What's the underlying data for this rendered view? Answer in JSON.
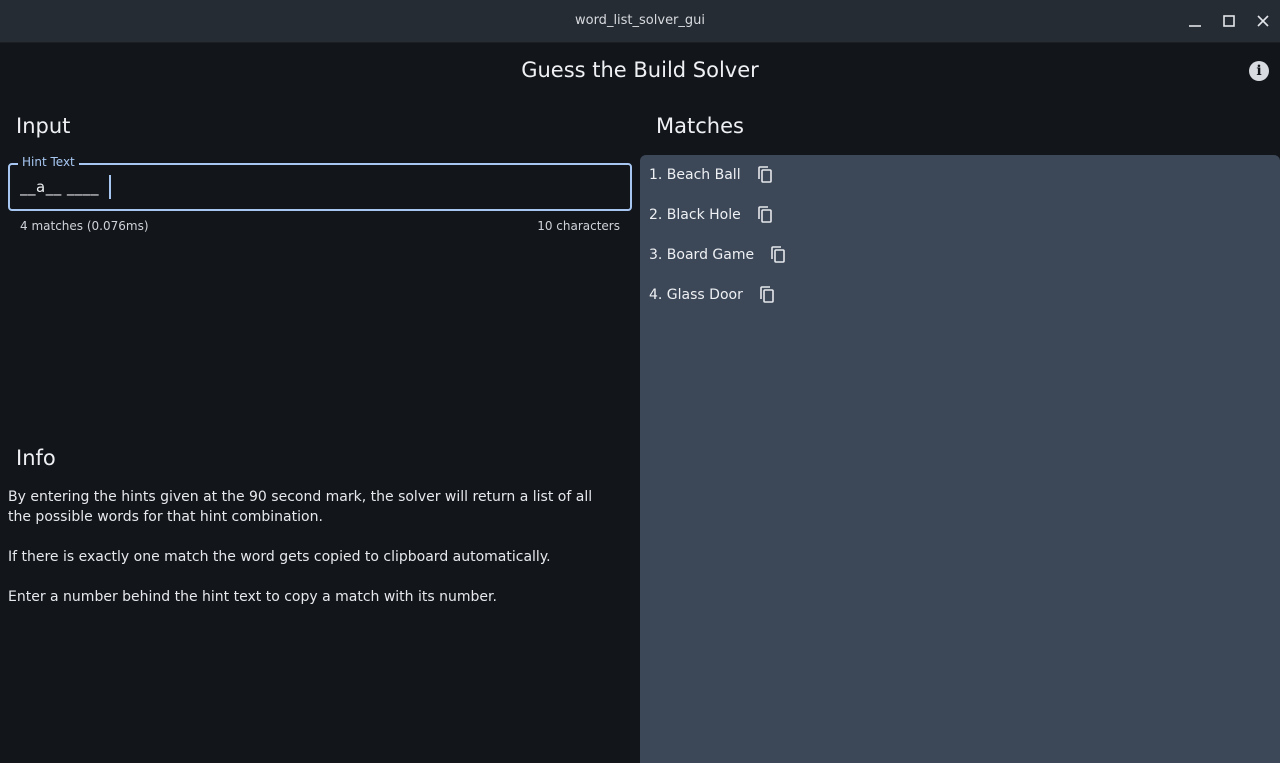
{
  "window": {
    "title": "word_list_solver_gui"
  },
  "app": {
    "title": "Guess the Build Solver",
    "info_button_glyph": "i"
  },
  "input": {
    "heading": "Input",
    "field_label": "Hint Text",
    "value": "__a__ ____",
    "match_status": "4 matches (0.076ms)",
    "char_count": "10 characters"
  },
  "matches": {
    "heading": "Matches",
    "items": [
      {
        "label": "1. Beach Ball"
      },
      {
        "label": "2. Black Hole"
      },
      {
        "label": "3. Board Game"
      },
      {
        "label": "4. Glass Door"
      }
    ]
  },
  "info": {
    "heading": "Info",
    "paragraphs": [
      "By entering the hints given at the 90 second mark, the solver will return a list of all the possible words for that hint combination.",
      "If there is exactly one match the word gets copied to clipboard automatically.",
      "Enter a number behind the hint text to copy a match with its number."
    ]
  },
  "icons": {
    "minimize": "minimize-icon",
    "maximize": "maximize-icon",
    "close": "close-icon",
    "info": "info-icon",
    "copy": "copy-icon"
  },
  "colors": {
    "background": "#12151a",
    "titlebar": "#262c33",
    "panel": "#3c4858",
    "accent": "#a7c7f2"
  }
}
